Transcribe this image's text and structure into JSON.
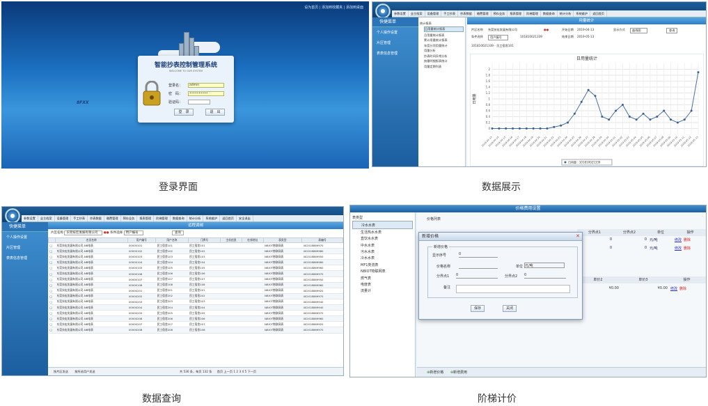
{
  "captions": [
    "登录界面",
    "数据展示",
    "数据查询",
    "阶梯计价"
  ],
  "login": {
    "top_links": "设为首页 | 添加到收藏夹 | 添加到桌面",
    "title": "智能抄表控制管理系统",
    "welcome": "WELCOME TO OUR SYSTEM",
    "user_label": "登录名：",
    "user_value": "admin",
    "pwd_label": "密　码：",
    "pwd_value": "••••••••••",
    "captcha_label": "验证码：",
    "captcha_value": "8FXX",
    "login_btn": "登　录",
    "exit_btn": "退　出"
  },
  "app": {
    "menu": [
      "参数设置",
      "业主档案",
      "设备管理",
      "手工抄表",
      "抄表数据",
      "缴费管理",
      "预存业务",
      "报表管理",
      "阶梯管理",
      "数据查询",
      "统计分析",
      "系统维护",
      "返回首页",
      "安全退出"
    ],
    "side_title": "快捷菜单",
    "side_items": [
      "个人操作设置",
      "片区管理",
      "表表信息管理"
    ]
  },
  "display": {
    "header": "用量统计",
    "tree": [
      "统计报表",
      "日用量统计报表",
      "月用量统计报表",
      "累计用量统计报表",
      "年度分项用量统计",
      "用量分析",
      "抄表时间异常分析",
      "按量明细报表统计",
      "用量定期列表"
    ],
    "area_label": "片区名称",
    "area_value": "东莞技宏发展有限公司",
    "start_label": "开始日期",
    "start_value": "2019-04-13",
    "end_label": "结束日期",
    "end_value": "2019-05-13",
    "cond_label": "条件选择",
    "cond_value": "用户编号",
    "cond_input": "101810021339",
    "show_label": "显示方式",
    "show_value": "曲线图",
    "query_btn": "查询",
    "selected_row": "101810021339 - 员工宿舍101"
  },
  "chart_data": {
    "type": "line",
    "title": "日用量统计",
    "ylabel": "日用量",
    "legend": "日用量 : 101810021339",
    "x": [
      "2019-04-13",
      "2019-04-14",
      "2019-04-15",
      "2019-04-16",
      "2019-04-17",
      "2019-04-18",
      "2019-04-19",
      "2019-04-20",
      "2019-04-21",
      "2019-04-22",
      "2019-04-23",
      "2019-04-24",
      "2019-04-25",
      "2019-04-26",
      "2019-04-27",
      "2019-04-28",
      "2019-04-29",
      "2019-04-30",
      "2019-05-01",
      "2019-05-02",
      "2019-05-03",
      "2019-05-04",
      "2019-05-05",
      "2019-05-06",
      "2019-05-07",
      "2019-05-08",
      "2019-05-09",
      "2019-05-10",
      "2019-05-11",
      "2019-05-12",
      "2019-05-13"
    ],
    "values": [
      0,
      0,
      0,
      0,
      0,
      0,
      0,
      0,
      0,
      0.05,
      0.1,
      0.2,
      0.5,
      0.9,
      1.3,
      1.1,
      0.4,
      0.3,
      0.6,
      0.8,
      0.4,
      0.3,
      0.5,
      0.3,
      0.4,
      0.6,
      0.3,
      0.2,
      0.3,
      0.6,
      1.9
    ],
    "ylim": [
      -0.2,
      2.2
    ],
    "yticks": [
      0,
      0.2,
      0.4,
      0.6,
      0.8,
      1.0,
      1.2,
      1.4,
      1.6,
      1.8,
      2.0
    ]
  },
  "query": {
    "header": "远程调阀",
    "area_label": "片区名称",
    "area_value": "东莞技宏发展有限公司",
    "cond_label": "条件选择",
    "cond_value": "用户编号",
    "query_btn": "查询",
    "columns": [
      "名员名称",
      "用户编号",
      "用户名称",
      "门牌号",
      "主机信息",
      "在线地址",
      "表类型",
      "表编号"
    ],
    "rows": [
      [
        "东莞技宏发展有限公司-NB电表",
        "00000101",
        "民工宿舍101",
        "民工宿舍101",
        "",
        "",
        "NBIOT物联网表",
        "402018869970"
      ],
      [
        "东莞技宏发展有限公司-NB电表",
        "00000102",
        "民工宿舍102",
        "民工宿舍102",
        "",
        "",
        "NBIOT物联网表",
        "402018869980"
      ],
      [
        "东莞技宏发展有限公司-NB电表",
        "00000103",
        "民工宿舍103",
        "民工宿舍103",
        "",
        "",
        "NBIOT物联网表",
        "402018869950"
      ],
      [
        "东莞技宏发展有限公司-NB电表",
        "00000104",
        "民工宿舍104",
        "民工宿舍104",
        "",
        "",
        "NBIOT物联网表",
        "402018869980"
      ],
      [
        "东莞技宏发展有限公司-NB电表",
        "00000105",
        "民工宿舍105",
        "民工宿舍105",
        "",
        "",
        "NBIOT物联网表",
        "402018869960"
      ],
      [
        "东莞技宏发展有限公司-NB电表",
        "00000106",
        "民工宿舍106",
        "民工宿舍106",
        "",
        "",
        "NBIOT物联网表",
        "402018869970"
      ],
      [
        "东莞技宏发展有限公司-NB电表",
        "00000107",
        "民工宿舍107",
        "民工宿舍107",
        "",
        "",
        "NBIOT物联网表",
        "402018869950"
      ],
      [
        "东莞技宏发展有限公司-NB电表",
        "00000108",
        "民工宿舍108",
        "民工宿舍108",
        "",
        "",
        "NBIOT物联网表",
        "402018869960"
      ],
      [
        "东莞技宏发展有限公司-NB电表",
        "00000201",
        "民工宿舍201",
        "民工宿舍201",
        "",
        "",
        "NBIOT物联网表",
        "402018869920"
      ],
      [
        "东莞技宏发展有限公司-NB电表",
        "00000202",
        "民工宿舍202",
        "民工宿舍202",
        "",
        "",
        "NBIOT物联网表",
        "402018869970"
      ],
      [
        "东莞技宏发展有限公司-NB电表",
        "00000203",
        "民工宿舍203",
        "民工宿舍203",
        "",
        "",
        "NBIOT物联网表",
        "402018869940"
      ],
      [
        "东莞技宏发展有限公司-NB电表",
        "00000204",
        "民工宿舍204",
        "民工宿舍204",
        "",
        "",
        "NBIOT物联网表",
        "402018869940"
      ],
      [
        "东莞技宏发展有限公司-NB电表",
        "00000205",
        "民工宿舍205",
        "民工宿舍205",
        "",
        "",
        "NBIOT物联网表",
        "402018869970"
      ],
      [
        "东莞技宏发展有限公司-NB电表",
        "00000206",
        "民工宿舍206",
        "民工宿舍206",
        "",
        "",
        "NBIOT物联网表",
        "402018869960"
      ],
      [
        "东莞技宏发展有限公司-NB电表",
        "00000207",
        "民工宿舍207",
        "民工宿舍207",
        "",
        "",
        "NBIOT物联网表",
        "402018869920"
      ],
      [
        "东莞技宏发展有限公司-NB电表",
        "00000208",
        "民工宿舍208",
        "民工宿舍208",
        "",
        "",
        "NBIOT物联网表",
        "402018869970"
      ]
    ],
    "btn_area": "按片区发送",
    "btn_user": "按所选用户发送",
    "total": "共 536 条，每页 132 条",
    "pager": [
      "首页",
      "上一页",
      "1",
      "2",
      "3",
      "4",
      "5",
      "下一页"
    ]
  },
  "price": {
    "header": "价格费用设置",
    "tree_root": "表类型",
    "tree": [
      "冷水水表",
      "生活热水水表",
      "直饮水水表",
      "中水水表",
      "污水水表",
      "冷水水表",
      "MF1类流表",
      "NBIOT物联网表",
      "燃气表",
      "电度表",
      "流量计"
    ],
    "list_title": "价格列表",
    "cols": [
      "分界点1",
      "分界点2",
      "单位",
      "操作"
    ],
    "row_vals": [
      "0",
      "0",
      "元/吨"
    ],
    "op_edit": "修改",
    "op_del": "删除",
    "cols2": [
      "单价2",
      "单价3",
      "操作"
    ],
    "row2_vals": [
      "¥0.00",
      "¥0.00"
    ],
    "dialog_title": "新增价格",
    "group": "新增价格",
    "f_seq": "显示序号",
    "f_seq_v": "0",
    "f_name": "价格名称",
    "f_unit": "单位",
    "f_unit_v": "元/吨",
    "f_p1": "分界点1",
    "f_p1_v": "0",
    "f_p2": "分界点2",
    "f_p2_v": "0",
    "f_note": "备注",
    "save": "保存",
    "close": "关闭",
    "add_price": "新增价格",
    "add_fee": "新增费用"
  }
}
